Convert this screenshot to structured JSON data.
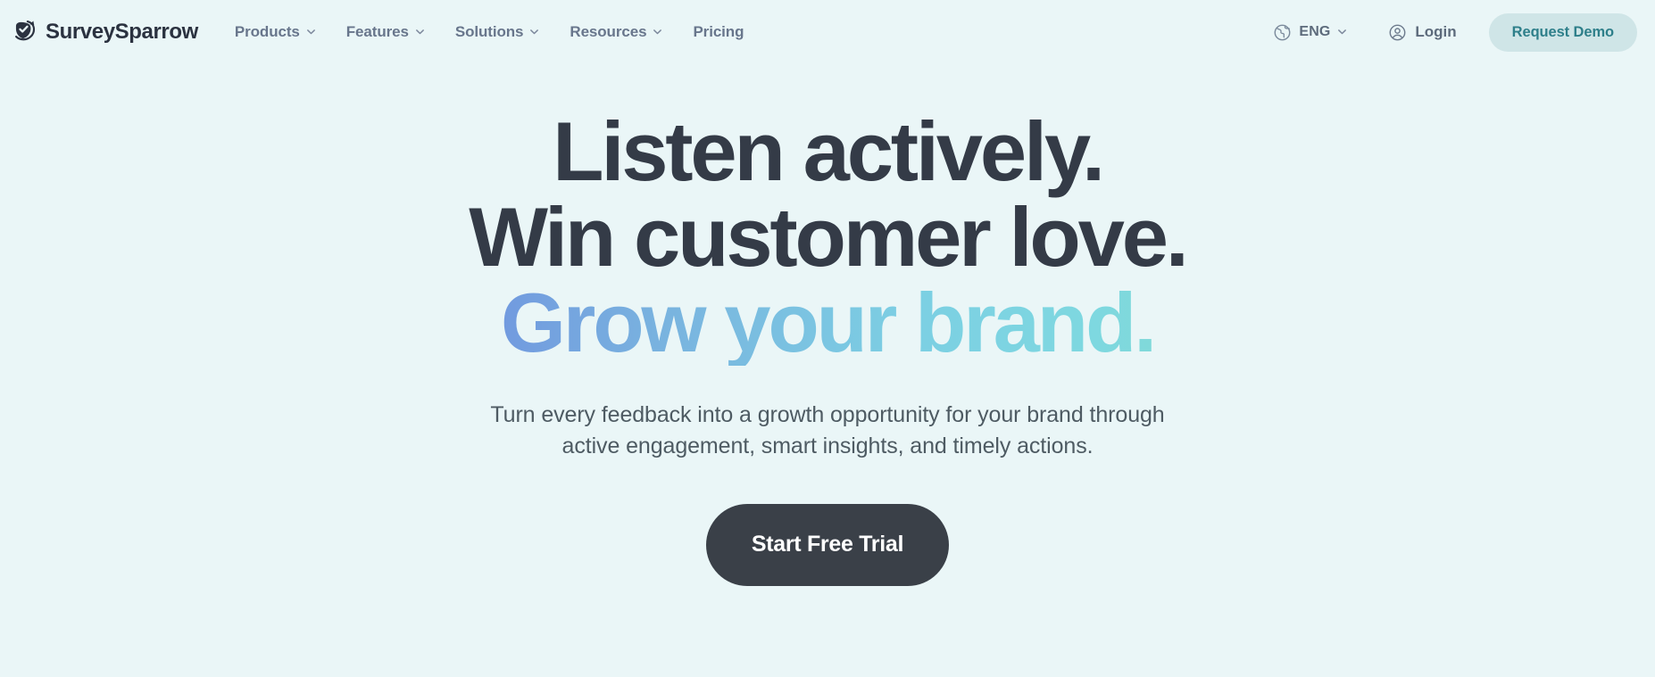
{
  "theme": {
    "page_background": "#eaf6f7",
    "headline_color": "#343b47",
    "nav_text_color": "#68768c",
    "demo_button_bg": "#cfe5e7",
    "demo_button_text": "#2e7f8a",
    "cta_button_bg": "#3a4048",
    "gradient_start": "#6168e0",
    "gradient_mid": "#7ccfe3",
    "gradient_end": "#82d389"
  },
  "header": {
    "logo": {
      "icon": "surveysparrow-bird-shield-check-icon",
      "wordmark": "SurveySparrow"
    },
    "nav_items": [
      {
        "label": "Products",
        "has_dropdown": true,
        "icon": "chevron-down-icon"
      },
      {
        "label": "Features",
        "has_dropdown": true,
        "icon": "chevron-down-icon"
      },
      {
        "label": "Solutions",
        "has_dropdown": true,
        "icon": "chevron-down-icon"
      },
      {
        "label": "Resources",
        "has_dropdown": true,
        "icon": "chevron-down-icon"
      },
      {
        "label": "Pricing",
        "has_dropdown": false,
        "icon": ""
      }
    ],
    "language": {
      "icon": "globe-icon",
      "label": "ENG",
      "chevron": "chevron-down-icon"
    },
    "login": {
      "icon": "user-circle-icon",
      "label": "Login"
    },
    "demo_button": {
      "label": "Request Demo"
    }
  },
  "hero": {
    "headline_lines": [
      {
        "text": "Listen actively.",
        "gradient": false
      },
      {
        "text": "Win customer love.",
        "gradient": false
      },
      {
        "text": "Grow your brand.",
        "gradient": true
      }
    ],
    "subhead_lines": [
      "Turn every feedback into a growth opportunity for your brand through",
      "active engagement, smart insights, and timely actions."
    ],
    "cta_button": {
      "label": "Start Free Trial"
    }
  }
}
